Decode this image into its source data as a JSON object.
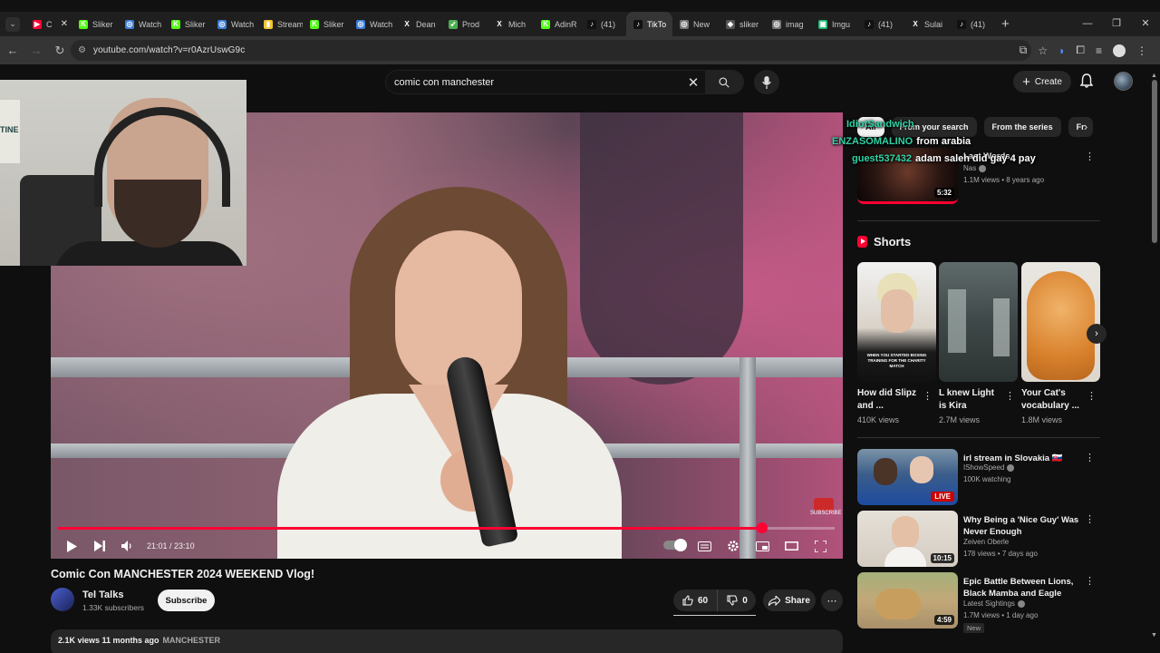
{
  "browser": {
    "tabs": [
      {
        "label": "C",
        "color": "#ff0033",
        "glyph": "▶",
        "active": false
      },
      {
        "label": "Sliker",
        "color": "#53fc18",
        "glyph": "K",
        "active": false
      },
      {
        "label": "Watch",
        "color": "#3a7bd5",
        "glyph": "◎",
        "active": false
      },
      {
        "label": "Sliker",
        "color": "#53fc18",
        "glyph": "K",
        "active": false
      },
      {
        "label": "Watch",
        "color": "#3a7bd5",
        "glyph": "◎",
        "active": false
      },
      {
        "label": "Stream",
        "color": "#f4c430",
        "glyph": "▮",
        "active": false
      },
      {
        "label": "Sliker",
        "color": "#53fc18",
        "glyph": "K",
        "active": false
      },
      {
        "label": "Watch",
        "color": "#3a7bd5",
        "glyph": "◎",
        "active": false
      },
      {
        "label": "Dean",
        "color": "#222222",
        "glyph": "X",
        "active": false
      },
      {
        "label": "Prod",
        "color": "#4caf50",
        "glyph": "➶",
        "active": false
      },
      {
        "label": "Mich",
        "color": "#222222",
        "glyph": "X",
        "active": false
      },
      {
        "label": "AdinR",
        "color": "#53fc18",
        "glyph": "K",
        "active": false
      },
      {
        "label": "(41)",
        "color": "#111111",
        "glyph": "♪",
        "active": false
      },
      {
        "label": "TikTo",
        "color": "#111111",
        "glyph": "♪",
        "active": true
      },
      {
        "label": "New",
        "color": "#777777",
        "glyph": "◎",
        "active": false
      },
      {
        "label": "sliker",
        "color": "#555555",
        "glyph": "◆",
        "active": false
      },
      {
        "label": "imag",
        "color": "#777777",
        "glyph": "◎",
        "active": false
      },
      {
        "label": "Imgu",
        "color": "#1bb76e",
        "glyph": "▣",
        "active": false
      },
      {
        "label": "(41)",
        "color": "#111111",
        "glyph": "♪",
        "active": false
      },
      {
        "label": "Sulai",
        "color": "#222222",
        "glyph": "X",
        "active": false
      },
      {
        "label": "(41)",
        "color": "#111111",
        "glyph": "♪",
        "active": false
      }
    ],
    "url": "youtube.com/watch?v=r0AzrUswG9c"
  },
  "header": {
    "search_value": "comic con manchester",
    "create_label": "Create"
  },
  "player": {
    "current_time": "21:01",
    "duration": "23:10",
    "progress_fraction": 0.907,
    "watermark_label": "SUBSCRIBE"
  },
  "video": {
    "title": "Comic Con MANCHESTER 2024 WEEKEND Vlog!",
    "channel": "Tel Talks",
    "subscribers": "1.33K subscribers",
    "subscribe_label": "Subscribe",
    "likes": "60",
    "dislikes": "0",
    "share_label": "Share",
    "views_date": "2.1K views  11 months ago",
    "hashtag": "MANCHESTER"
  },
  "chips": [
    "All",
    "From your search",
    "From the series",
    "Fr"
  ],
  "chat": [
    {
      "user": "IdiotSandwich",
      "message": ""
    },
    {
      "user": "ENZASOMALINO",
      "message": "from arabia"
    },
    {
      "user": "guest537432",
      "message": "adam saleh did gay 4 pay"
    }
  ],
  "related_top": {
    "title": "Last Words",
    "channel": "Nas",
    "meta": "1.1M views • 8 years ago",
    "duration": "5:32"
  },
  "shorts": {
    "heading": "Shorts",
    "items": [
      {
        "title": "How did Slipz and ...",
        "views": "410K views",
        "caption": "WHEN YOU STARTED BOXING TRAINING FOR THE CHARITY MATCH"
      },
      {
        "title": "L knew Light is Kira",
        "views": "2.7M views"
      },
      {
        "title": "Your Cat's vocabulary ...",
        "views": "1.8M views"
      }
    ]
  },
  "related": [
    {
      "title": "irl stream in Slovakia 🇸🇰",
      "channel": "IShowSpeed",
      "meta": "100K watching",
      "live_label": "LIVE"
    },
    {
      "title": "Why Being a 'Nice Guy' Was Never Enough",
      "channel": "Zeiven Oberle",
      "meta": "178 views • 7 days ago",
      "duration": "10:15"
    },
    {
      "title": "Epic Battle Between Lions, Black Mamba and Eagle",
      "channel": "Latest Sightings",
      "meta": "1.7M views • 1 day ago",
      "duration": "4:59",
      "badge": "New"
    }
  ],
  "colors": {
    "accent": "#ff0033",
    "chat_name": "#2fd3a5"
  }
}
